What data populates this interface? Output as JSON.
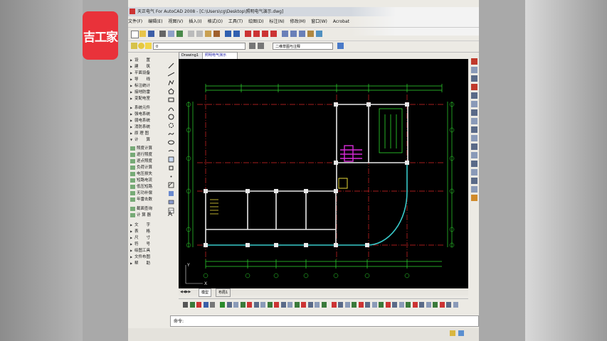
{
  "watermark": {
    "logo_text": "吉工家",
    "brand_color": "#e9323a"
  },
  "window": {
    "title": "天正电气 For AutoCAD 2008 - [C:\\Users\\cg\\Desktop\\照明电气演示.dwg]"
  },
  "menu": [
    "文件(F)",
    "编辑(E)",
    "视图(V)",
    "插入(I)",
    "格式(O)",
    "工具(T)",
    "绘图(D)",
    "标注(N)",
    "修改(M)",
    "窗口(W)",
    "Acrobat"
  ],
  "toolbar": {
    "layer_value": "0",
    "style_value": "二维草图与注释"
  },
  "doc_tabs": [
    "Drawing1",
    "照明电气演示"
  ],
  "layout_tabs": [
    "模型",
    "布局1"
  ],
  "left_panel": [
    {
      "label": "设　　置",
      "type": "arrow"
    },
    {
      "label": "建　　筑",
      "type": "arrow"
    },
    {
      "label": "平面设备",
      "type": "arrow"
    },
    {
      "label": "导　　线",
      "type": "arrow"
    },
    {
      "label": "标注统计",
      "type": "arrow"
    },
    {
      "label": "接地防雷",
      "type": "arrow"
    },
    {
      "label": "变配电室",
      "type": "arrow"
    },
    {
      "label": "系统元件",
      "type": "arrow"
    },
    {
      "label": "强电系统",
      "type": "arrow"
    },
    {
      "label": "弱电系统",
      "type": "arrow"
    },
    {
      "label": "消防系统",
      "type": "arrow"
    },
    {
      "label": "原 理 图",
      "type": "arrow"
    },
    {
      "label": "计　　算",
      "type": "open"
    },
    {
      "label": "照度计算",
      "type": "icon"
    },
    {
      "label": "逐行照度",
      "type": "icon"
    },
    {
      "label": "逐点照度",
      "type": "icon"
    },
    {
      "label": "负荷计算",
      "type": "icon"
    },
    {
      "label": "电压损失",
      "type": "icon"
    },
    {
      "label": "短路电流",
      "type": "icon"
    },
    {
      "label": "低压短路",
      "type": "icon"
    },
    {
      "label": "无功补偿",
      "type": "icon"
    },
    {
      "label": "年雷击数",
      "type": "icon"
    },
    {
      "label": "截面查询",
      "type": "icon"
    },
    {
      "label": "计 算 器",
      "type": "icon"
    },
    {
      "label": "文　　字",
      "type": "arrow"
    },
    {
      "label": "表　　格",
      "type": "arrow"
    },
    {
      "label": "尺　　寸",
      "type": "arrow"
    },
    {
      "label": "符　　号",
      "type": "arrow"
    },
    {
      "label": "绘图工具",
      "type": "arrow"
    },
    {
      "label": "文件布图",
      "type": "arrow"
    },
    {
      "label": "帮　　助",
      "type": "arrow"
    }
  ],
  "command_line": {
    "prompt": "命令:"
  },
  "canvas_colors": {
    "wall": "#e8e8e8",
    "axis": "#d92626",
    "dim": "#2fdc2f",
    "curve": "#38c9c9",
    "accent": "#d82bd8"
  }
}
